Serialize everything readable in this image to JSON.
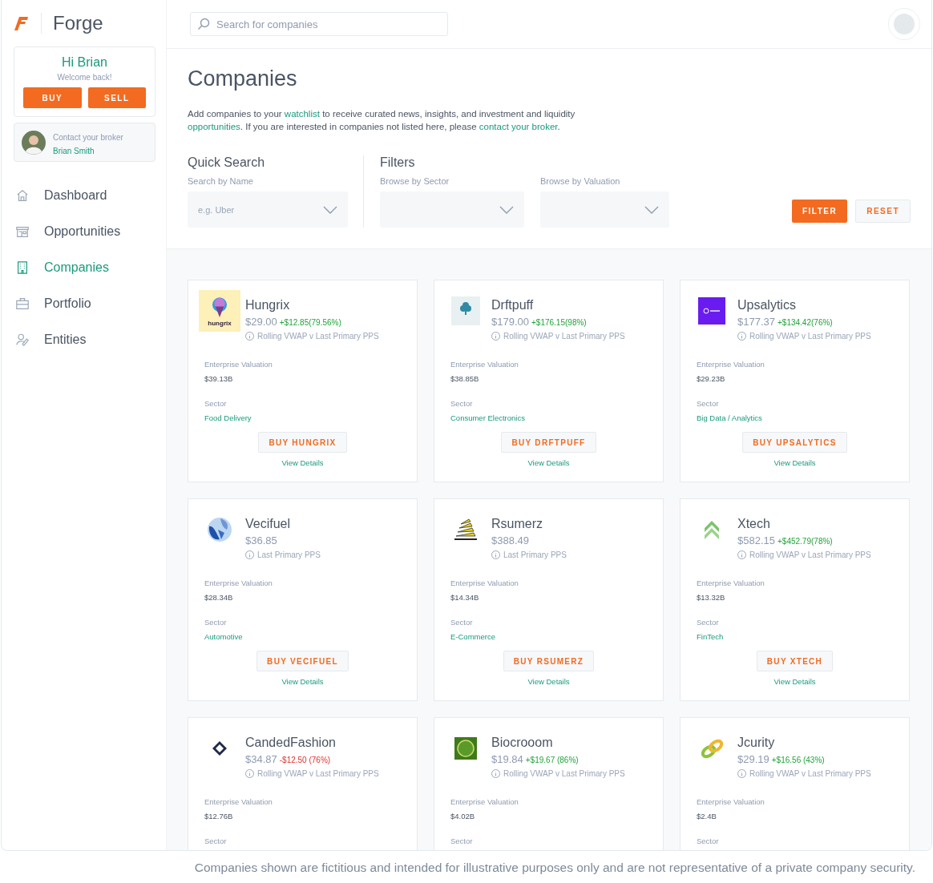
{
  "app": {
    "name": "Forge"
  },
  "search": {
    "placeholder": "Search for companies"
  },
  "greeting": {
    "title": "Hi Brian",
    "subtitle": "Welcome back!",
    "buttons": [
      "BUY",
      "SELL"
    ]
  },
  "broker": {
    "label": "Contact your broker",
    "name": "Brian Smith"
  },
  "nav": [
    {
      "label": "Dashboard",
      "selected": false
    },
    {
      "label": "Opportunities",
      "selected": false
    },
    {
      "label": "Companies",
      "selected": true
    },
    {
      "label": "Portfolio",
      "selected": false
    },
    {
      "label": "Entities",
      "selected": false
    }
  ],
  "page": {
    "title": "Companies",
    "description": [
      {
        "kind": "text",
        "text": "Add companies to your "
      },
      {
        "kind": "link",
        "text": "watchlist"
      },
      {
        "kind": "text",
        "text": " to receive curated news, insights, and investment and liquidity "
      },
      {
        "kind": "link",
        "text": "opportunities"
      },
      {
        "kind": "text",
        "text": ". If you are interested in companies not listed here, please "
      },
      {
        "kind": "link",
        "text": "contact your broker"
      },
      {
        "kind": "text",
        "text": "."
      }
    ]
  },
  "quick_search": {
    "title": "Quick Search",
    "label": "Search by Name",
    "placeholder": "e.g. Uber"
  },
  "filters": {
    "title": "Filters",
    "fields": [
      {
        "label": "Browse by Sector"
      },
      {
        "label": "Browse by Valuation"
      }
    ],
    "buttons": [
      {
        "label": "FILTER",
        "kind": "primary"
      },
      {
        "label": "RESET",
        "kind": "secondary"
      }
    ]
  },
  "companies": [
    {
      "name": "Hungrix",
      "logo_text": "hungrix",
      "price": "$29.00",
      "change": "+$12.85(79.56%)",
      "negative": false,
      "price_note": "Rolling VWAP v Last Primary PPS",
      "valuation_label": "Enterprise Valuation",
      "valuation": "$39.13B",
      "sector_label": "Sector",
      "sector": "Food Delivery",
      "buy_label": "BUY HUNGRIX",
      "details_label": "View Details"
    },
    {
      "name": "Drftpuff",
      "price": "$179.00",
      "change": "+$176.15(98%)",
      "negative": false,
      "price_note": "Rolling VWAP v Last Primary PPS",
      "valuation_label": "Enterprise Valuation",
      "valuation": "$38.85B",
      "sector_label": "Sector",
      "sector": "Consumer Electronics",
      "buy_label": "BUY DRFTPUFF",
      "details_label": "View Details"
    },
    {
      "name": "Upsalytics",
      "price": "$177.37",
      "change": "+$134.42(76%)",
      "negative": false,
      "price_note": "Rolling VWAP v Last Primary PPS",
      "valuation_label": "Enterprise Valuation",
      "valuation": "$29.23B",
      "sector_label": "Sector",
      "sector": "Big Data / Analytics",
      "buy_label": "BUY UPSALYTICS",
      "details_label": "View Details"
    },
    {
      "name": "Vecifuel",
      "price": "$36.85",
      "price_note": "Last Primary PPS",
      "valuation_label": "Enterprise Valuation",
      "valuation": "$28.34B",
      "sector_label": "Sector",
      "sector": "Automotive",
      "buy_label": "BUY VECIFUEL",
      "details_label": "View Details"
    },
    {
      "name": "Rsumerz",
      "price": "$388.49",
      "price_note": "Last Primary PPS",
      "valuation_label": "Enterprise Valuation",
      "valuation": "$14.34B",
      "sector_label": "Sector",
      "sector": "E-Commerce",
      "buy_label": "BUY RSUMERZ",
      "details_label": "View Details"
    },
    {
      "name": "Xtech",
      "price": "$582.15",
      "change": "+$452.79(78%)",
      "negative": false,
      "price_note": "Rolling VWAP v Last Primary PPS",
      "valuation_label": "Enterprise Valuation",
      "valuation": "$13.32B",
      "sector_label": "Sector",
      "sector": "FinTech",
      "buy_label": "BUY XTECH",
      "details_label": "View Details"
    },
    {
      "name": "CandedFashion",
      "price": "$34.87",
      "change": "-$12.50 (76%)",
      "negative": true,
      "price_note": "Rolling VWAP v Last Primary PPS",
      "valuation_label": "Enterprise Valuation",
      "valuation": "$12.76B",
      "sector_label": "Sector"
    },
    {
      "name": "Biocrooom",
      "price": "$19.84",
      "change": "+$19.67 (86%)",
      "negative": false,
      "price_note": "Rolling VWAP v Last Primary PPS",
      "valuation_label": "Enterprise Valuation",
      "valuation": "$4.02B",
      "sector_label": "Sector"
    },
    {
      "name": "Jcurity",
      "price": "$29.19",
      "change": "+$16.56 (43%)",
      "negative": false,
      "price_note": "Rolling VWAP v Last Primary PPS",
      "valuation_label": "Enterprise Valuation",
      "valuation": "$2.4B",
      "sector_label": "Sector"
    }
  ],
  "footnote": "Companies shown are fictitious and intended for illustrative purposes only and are not representative of a private company security."
}
